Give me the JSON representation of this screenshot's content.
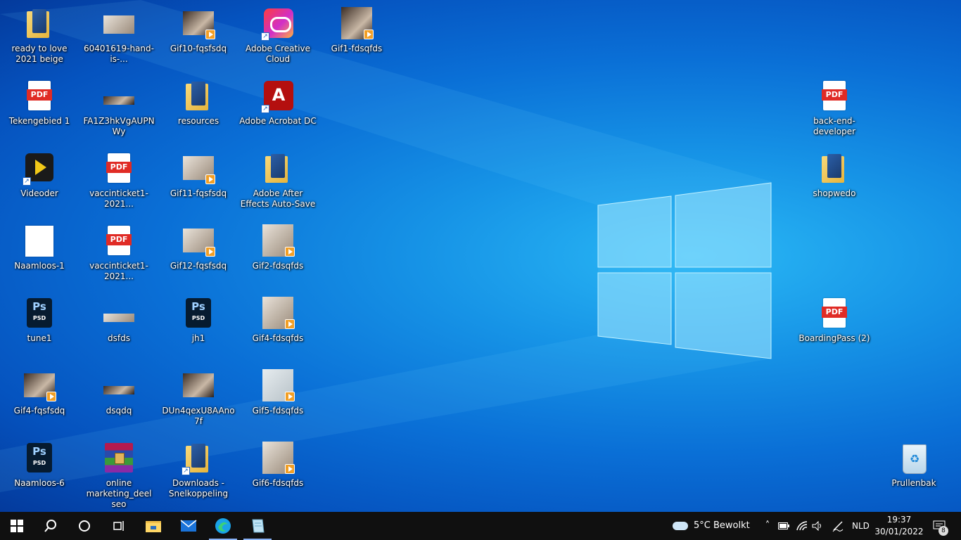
{
  "desktop_icons": [
    {
      "label": "ready to love 2021 beige",
      "icon": "folder-icon"
    },
    {
      "label": "60401619-hand-is-...",
      "icon": "image-thumbnail"
    },
    {
      "label": "Gif10-fqsfsdq",
      "icon": "video-thumbnail"
    },
    {
      "label": "Adobe Creative Cloud",
      "icon": "creative-cloud-icon"
    },
    {
      "label": "Gif1-fdsqfds",
      "icon": "video-thumbnail"
    },
    {
      "label": "Tekengebied 1",
      "icon": "pdf-icon"
    },
    {
      "label": "FA1Z3hkVgAUPNWy",
      "icon": "image-thumbnail"
    },
    {
      "label": "resources",
      "icon": "folder-icon"
    },
    {
      "label": "Adobe Acrobat DC",
      "icon": "acrobat-icon"
    },
    {
      "label": "Videoder",
      "icon": "videoder-icon"
    },
    {
      "label": "vaccinticket1-2021...",
      "icon": "pdf-icon"
    },
    {
      "label": "Gif11-fqsfsdq",
      "icon": "video-thumbnail"
    },
    {
      "label": "Adobe After Effects Auto-Save",
      "icon": "folder-icon"
    },
    {
      "label": "Naamloos-1",
      "icon": "document-icon"
    },
    {
      "label": "vaccinticket1-2021...",
      "icon": "pdf-icon"
    },
    {
      "label": "Gif12-fqsfsdq",
      "icon": "video-thumbnail"
    },
    {
      "label": "Gif2-fdsqfds",
      "icon": "video-thumbnail"
    },
    {
      "label": "tune1",
      "icon": "psd-icon"
    },
    {
      "label": "dsfds",
      "icon": "image-thumbnail"
    },
    {
      "label": "jh1",
      "icon": "psd-icon"
    },
    {
      "label": "Gif4-fdsqfds",
      "icon": "video-thumbnail"
    },
    {
      "label": "Gif4-fqsfsdq",
      "icon": "video-thumbnail"
    },
    {
      "label": "dsqdq",
      "icon": "image-thumbnail"
    },
    {
      "label": "DUn4qexU8AAno7f",
      "icon": "image-thumbnail"
    },
    {
      "label": "Gif5-fdsqfds",
      "icon": "video-thumbnail"
    },
    {
      "label": "Naamloos-6",
      "icon": "psd-icon"
    },
    {
      "label": "online marketing_deel seo",
      "icon": "winrar-icon"
    },
    {
      "label": "Downloads - Snelkoppeling",
      "icon": "downloads-folder-icon"
    },
    {
      "label": "Gif6-fdsqfds",
      "icon": "video-thumbnail"
    },
    {
      "label": "back-end-developer",
      "icon": "pdf-icon"
    },
    {
      "label": "shopwedo",
      "icon": "folder-icon"
    },
    {
      "label": "BoardingPass (2)",
      "icon": "pdf-icon"
    },
    {
      "label": "Prullenbak",
      "icon": "recycle-bin-icon"
    }
  ],
  "taskbar": {
    "start": "start-icon",
    "search": "search-icon",
    "cortana": "cortana-icon",
    "taskview": "task-view-icon",
    "apps": [
      "file-explorer-icon",
      "mail-icon",
      "edge-icon",
      "notepad-icon"
    ],
    "weather": "5°C  Bewolkt",
    "language": "NLD",
    "time": "19:37",
    "date": "30/01/2022",
    "notifications": "8"
  }
}
